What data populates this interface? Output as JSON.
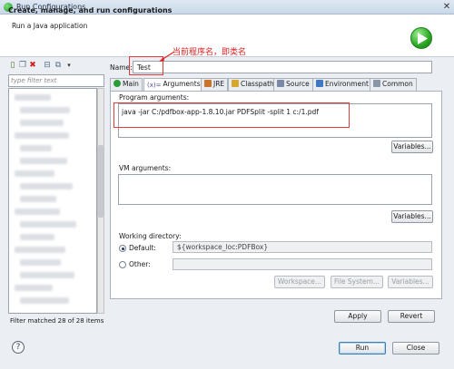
{
  "window": {
    "title": "Run Configurations"
  },
  "header": {
    "title": "Create, manage, and run configurations",
    "subtitle": "Run a Java application"
  },
  "left_panel": {
    "filter_placeholder": "type filter text",
    "status": "Filter matched 28 of 28 items"
  },
  "form": {
    "name_label": "Name:",
    "name_value": "Test",
    "annotation": "当前程序名，即类名",
    "tabs": [
      {
        "label": "Main",
        "icon": "main-tab-icon"
      },
      {
        "label": "Arguments",
        "icon": "arguments-tab-icon"
      },
      {
        "label": "JRE",
        "icon": "jre-tab-icon"
      },
      {
        "label": "Classpath",
        "icon": "classpath-tab-icon"
      },
      {
        "label": "Source",
        "icon": "source-tab-icon"
      },
      {
        "label": "Environment",
        "icon": "environment-tab-icon"
      },
      {
        "label": "Common",
        "icon": "common-tab-icon"
      }
    ],
    "program_arguments_label": "Program arguments:",
    "program_arguments_value": "java -jar C:/pdfbox-app-1.8.10.jar PDFSplit -split 1 c:/1.pdf",
    "variables_label": "Variables...",
    "vm_arguments_label": "VM arguments:",
    "vm_arguments_value": "",
    "working_directory_label": "Working directory:",
    "default_label": "Default:",
    "default_value": "${workspace_loc:PDFBox}",
    "other_label": "Other:",
    "other_value": "",
    "workspace_btn": "Workspace...",
    "filesystem_btn": "File System...",
    "variables_btn3": "Variables..."
  },
  "buttons": {
    "apply": "Apply",
    "revert": "Revert",
    "run": "Run",
    "close": "Close",
    "help": "?"
  },
  "colors": {
    "annotation_red": "#e03a3a",
    "run_green": "#2aa524"
  }
}
